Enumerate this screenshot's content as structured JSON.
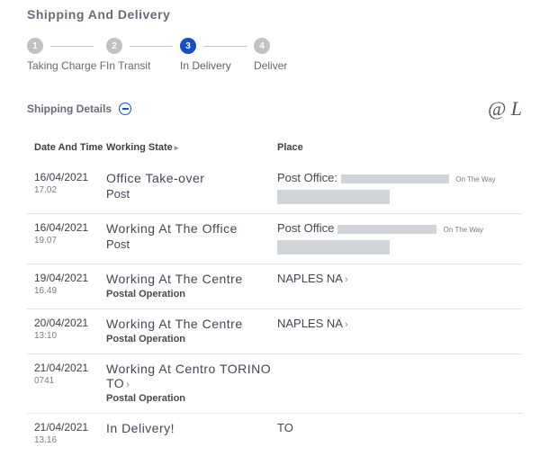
{
  "title": "Shipping And Delivery",
  "stepper": {
    "steps": [
      {
        "num": "1",
        "label": "Taking Charge F",
        "active": false
      },
      {
        "num": "2",
        "label": "In Transit",
        "active": false
      },
      {
        "num": "3",
        "label": "In Delivery",
        "active": true
      },
      {
        "num": "4",
        "label": "Deliver",
        "active": false
      }
    ]
  },
  "details": {
    "label": "Shipping Details",
    "brand": "@ L"
  },
  "headers": {
    "datetime": "Date And Time",
    "state": "Working State",
    "place": "Place"
  },
  "rows": [
    {
      "date": "16/04/2021",
      "time": "17.02",
      "state1": "Office Take-over",
      "state2": "Post",
      "stateSub": "",
      "place": "Post Office:",
      "redacted": true,
      "badge": "On The Way"
    },
    {
      "date": "16/04/2021",
      "time": "19.07",
      "state1": "Working At The Office",
      "state2": "Post",
      "stateSub": "",
      "place": "Post Office",
      "redacted": true,
      "badge": "On The Way"
    },
    {
      "date": "19/04/2021",
      "time": "16.49",
      "state1": "Working At The Centre",
      "state2": "",
      "stateSub": "Postal Operation",
      "place": "NAPLES NA",
      "redacted": false,
      "badge": ""
    },
    {
      "date": "20/04/2021",
      "time": "13:10",
      "state1": "Working At The Centre",
      "state2": "",
      "stateSub": "Postal Operation",
      "place": "NAPLES NA",
      "redacted": false,
      "badge": ""
    },
    {
      "date": "21/04/2021",
      "time": "0741",
      "state1": "Working At Centro TORINO TO",
      "state2": "",
      "stateSub": "Postal Operation",
      "place": "",
      "redacted": false,
      "badge": "",
      "caret": true
    },
    {
      "date": "21/04/2021",
      "time": "13.16",
      "state1": "In Delivery!",
      "state2": "",
      "stateSub": "",
      "place": "TO",
      "redacted": false,
      "badge": ""
    }
  ]
}
